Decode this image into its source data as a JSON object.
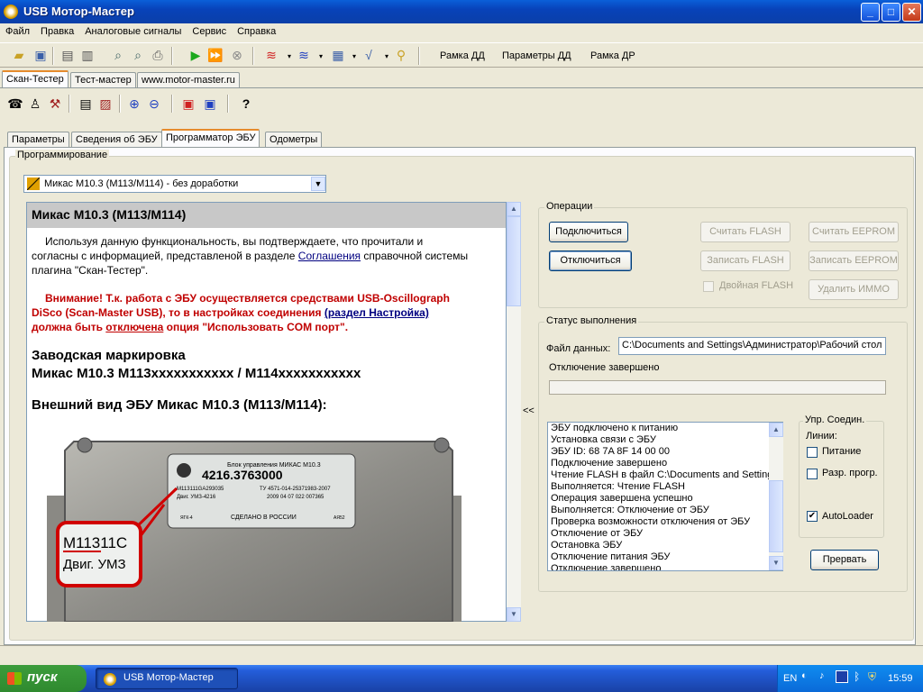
{
  "window": {
    "title": "USB Мотор-Мастер",
    "min": "_",
    "max": "□",
    "close": "✕"
  },
  "menu": [
    "Файл",
    "Правка",
    "Аналоговые сигналы",
    "Сервис",
    "Справка"
  ],
  "toolbar1": {
    "frame_dd": "Рамка ДД",
    "params_dd": "Параметры ДД",
    "frame_dr": "Рамка ДР"
  },
  "main_tabs": [
    "Скан-Тестер",
    "Тест-мастер",
    "www.motor-master.ru"
  ],
  "sub_tabs": [
    "Параметры",
    "Сведения об ЭБУ",
    "Программатор ЭБУ",
    "Одометры"
  ],
  "programming": {
    "group_label": "Программирование",
    "selected_ecu": "Микас М10.3 (М113/М114) - без доработки"
  },
  "doc": {
    "header": "Микас М10.3 (М113/М114)",
    "p1a": "Используя данную функциональность, вы подтверждаете, что прочитали и",
    "p1b": "согласны с информацией, представленой в разделе ",
    "p1_link": "Соглашения",
    "p1c": " справочной системы",
    "p1d": "плагина \"Скан-Тестер\".",
    "warn1": "Внимание! Т.к. работа с ЭБУ осуществляется средствами USB-Oscillograph",
    "warn2a": "DiSco (Scan-Master USB), то в настройках соединения ",
    "warn2_link": "(раздел Настройка)",
    "warn3a": "должна быть ",
    "warn3_link": "отключена",
    "warn3b": " опция \"Использовать COM порт\".",
    "marking_title": "Заводская маркировка",
    "marking_value": "Микас М10.3 М113xxxxxxxxxxx / М114xxxxxxxxxxx",
    "view_title": "Внешний вид ЭБУ Микас М10.3 (М113/М114):",
    "label": {
      "line1": "Блок управления  МИКАС М10.3",
      "number": "4216.3763000",
      "line3a": "M113111GA293035",
      "line3b": "ТУ 4571-014-25371983-2007",
      "line4a": "Двиг. УМЗ-4216",
      "line4b": "2009 04 07  022  007365",
      "line5a": "ЯГК-4",
      "line5b": "СДЕЛАНО В РОССИИ",
      "line5c": "АЯ52",
      "zoom1": "М11311С",
      "zoom2": "Двиг. УМЗ"
    }
  },
  "splitter": "<<",
  "operations": {
    "label": "Операции",
    "connect": "Подключиться",
    "disconnect": "Отключиться",
    "read_flash": "Считать FLASH",
    "write_flash": "Записать FLASH",
    "double_flash": "Двойная FLASH",
    "read_eeprom": "Считать EEPROM",
    "write_eeprom": "Записать EEPROM",
    "remove_immo": "Удалить ИММО"
  },
  "status": {
    "label": "Статус выполнения",
    "file_label": "Файл данных:",
    "file_value": "C:\\Documents and Settings\\Администратор\\Рабочий стол",
    "state": "Отключение завершено",
    "progress": 0,
    "log": [
      "ЭБУ подключено к питанию",
      "Установка связи с ЭБУ",
      "ЭБУ ID: 68 7A 8F 14 00 00",
      "Подключение завершено",
      "Чтение FLASH в файл C:\\Documents and Setting",
      "Выполняется: Чтение FLASH",
      "Операция завершена успешно",
      "Выполняется: Отключение от ЭБУ",
      "Проверка возможности отключения от ЭБУ",
      "Отключение от ЭБУ",
      "Остановка ЭБУ",
      "Отключение питания ЭБУ",
      "Отключение завершено"
    ],
    "control_label": "Упр. Соедин.",
    "lines_label": "Линии:",
    "power": "Питание",
    "power_checked": false,
    "unlock": "Разр. прогр.",
    "unlock_checked": false,
    "autoloader": "AutoLoader",
    "autoloader_checked": true,
    "abort": "Прервать"
  },
  "taskbar": {
    "start": "пуск",
    "task": "USB Мотор-Мастер",
    "lang": "EN",
    "time": "15:59"
  }
}
